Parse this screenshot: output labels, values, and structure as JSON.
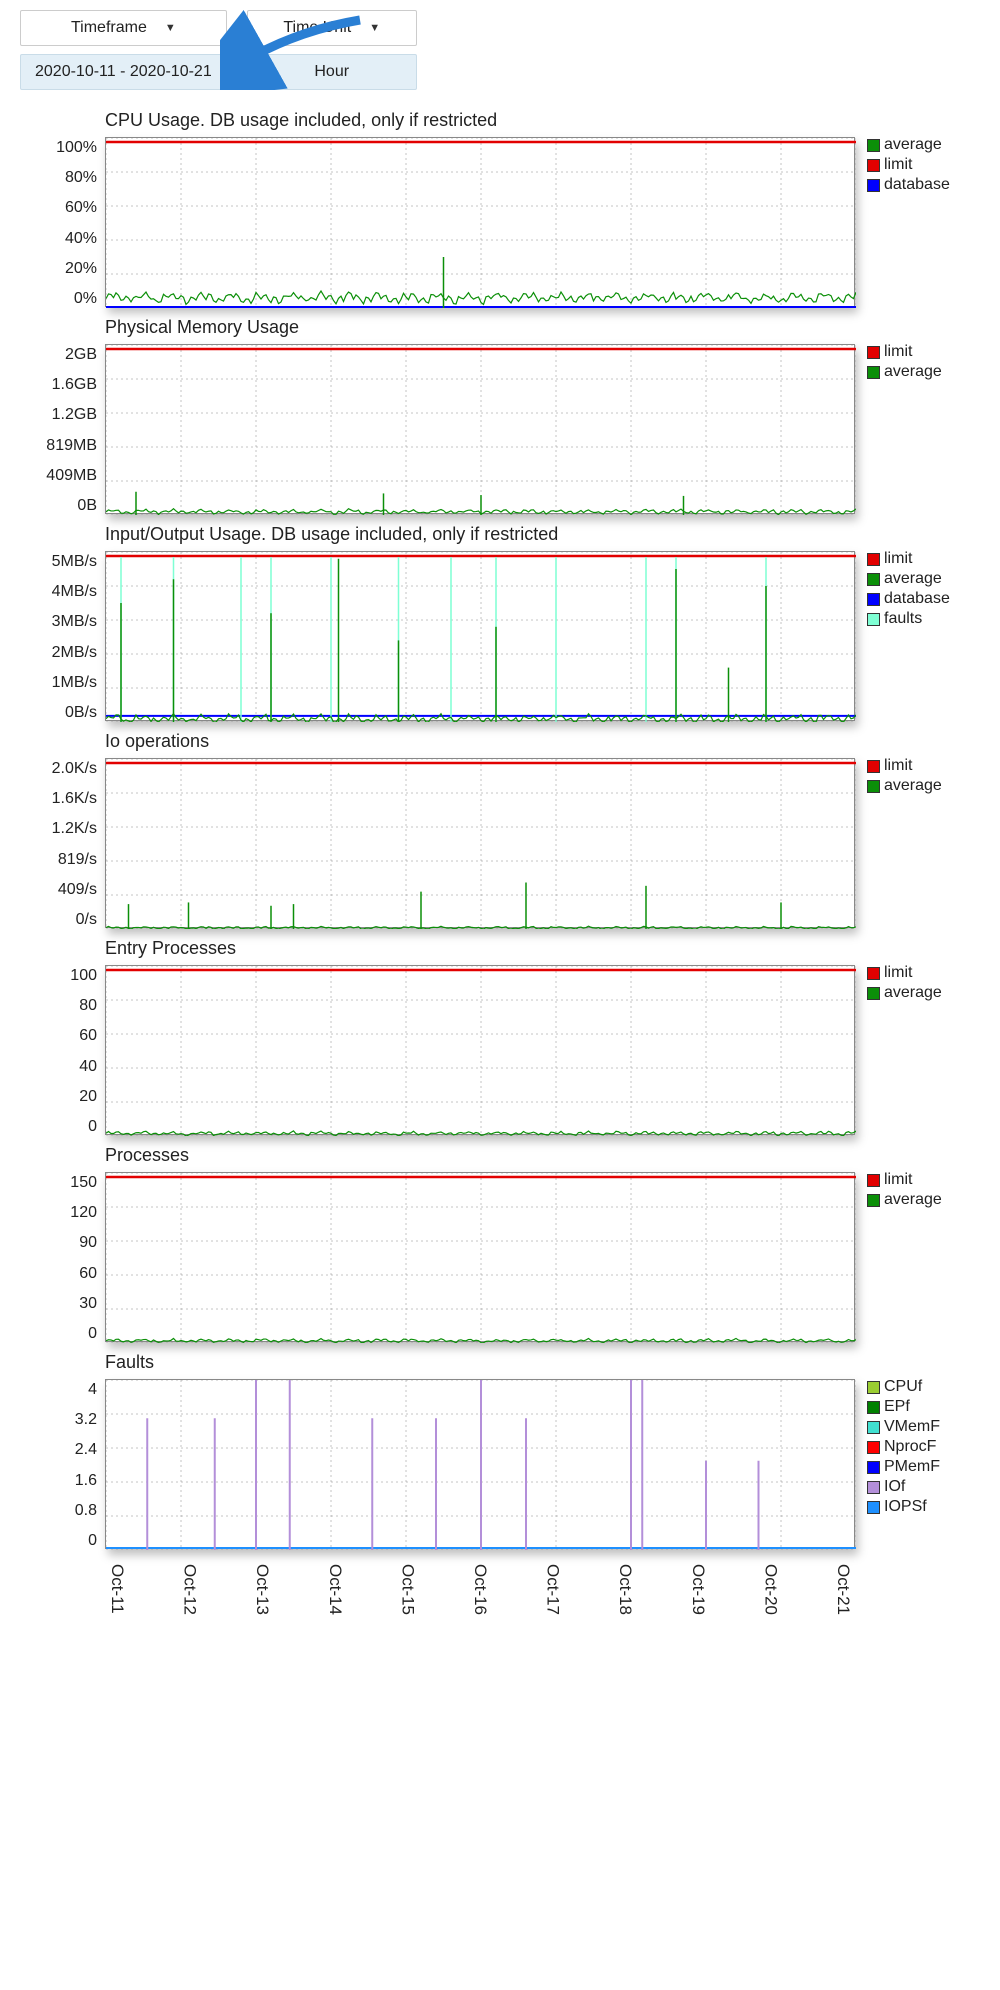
{
  "controls": {
    "timeframe_label": "Timeframe",
    "timeunit_label": "Time Unit",
    "timeframe_value": "2020-10-11 - 2020-10-21",
    "timeunit_value": "Hour"
  },
  "xaxis_labels": [
    "Oct-11",
    "Oct-12",
    "Oct-13",
    "Oct-14",
    "Oct-15",
    "Oct-16",
    "Oct-17",
    "Oct-18",
    "Oct-19",
    "Oct-20",
    "Oct-21"
  ],
  "colors": {
    "average": "#0b8f08",
    "limit": "#e20000",
    "database": "#0000ff",
    "faults": "#7fffd4",
    "CPUf": "#9acd32",
    "EPf": "#008000",
    "VMemF": "#40e0d0",
    "NprocF": "#ff0000",
    "PMemF": "#0000ff",
    "IOf": "#b38fd9",
    "IOPSf": "#1e90ff"
  },
  "chart_data": [
    {
      "id": "cpu",
      "type": "line",
      "title": "CPU Usage. DB usage included, only if restricted",
      "ylabels": [
        "100%",
        "80%",
        "60%",
        "40%",
        "20%",
        "0%"
      ],
      "ymax": 100,
      "limit": 100,
      "legend": [
        {
          "name": "average",
          "color": "#0b8f08"
        },
        {
          "name": "limit",
          "color": "#e20000"
        },
        {
          "name": "database",
          "color": "#0000ff"
        }
      ],
      "series": {
        "average_baseline": 6,
        "average_noise": 4,
        "spikes": [
          {
            "x": 0.45,
            "v": 30
          }
        ],
        "database_baseline": 0
      }
    },
    {
      "id": "pmem",
      "type": "line",
      "title": "Physical Memory Usage",
      "ylabels": [
        "2GB",
        "1.6GB",
        "1.2GB",
        "819MB",
        "409MB",
        "0B"
      ],
      "ymax": 2048,
      "limit": 2048,
      "legend": [
        {
          "name": "limit",
          "color": "#e20000"
        },
        {
          "name": "average",
          "color": "#0b8f08"
        }
      ],
      "series": {
        "average_baseline": 40,
        "average_noise": 35,
        "spikes": [
          {
            "x": 0.04,
            "v": 280
          },
          {
            "x": 0.37,
            "v": 260
          },
          {
            "x": 0.5,
            "v": 240
          },
          {
            "x": 0.77,
            "v": 230
          }
        ]
      }
    },
    {
      "id": "io",
      "type": "line",
      "title": "Input/Output Usage. DB usage included, only if restricted",
      "ylabels": [
        "5MB/s",
        "4MB/s",
        "3MB/s",
        "2MB/s",
        "1MB/s",
        "0B/s"
      ],
      "ymax": 5,
      "limit": 5,
      "legend": [
        {
          "name": "limit",
          "color": "#e20000"
        },
        {
          "name": "average",
          "color": "#0b8f08"
        },
        {
          "name": "database",
          "color": "#0000ff"
        },
        {
          "name": "faults",
          "color": "#7fffd4"
        }
      ],
      "series": {
        "average_baseline": 0.1,
        "average_noise": 0.15,
        "database_baseline": 0.15,
        "fault_spikes": [
          0.02,
          0.09,
          0.18,
          0.22,
          0.3,
          0.39,
          0.46,
          0.52,
          0.6,
          0.72,
          0.76,
          0.88
        ],
        "avg_spikes": [
          {
            "x": 0.02,
            "v": 3.5
          },
          {
            "x": 0.09,
            "v": 4.2
          },
          {
            "x": 0.22,
            "v": 3.2
          },
          {
            "x": 0.31,
            "v": 4.8
          },
          {
            "x": 0.39,
            "v": 2.4
          },
          {
            "x": 0.52,
            "v": 2.8
          },
          {
            "x": 0.76,
            "v": 4.5
          },
          {
            "x": 0.83,
            "v": 1.6
          },
          {
            "x": 0.88,
            "v": 4.0
          }
        ]
      }
    },
    {
      "id": "iops",
      "type": "line",
      "title": "Io operations",
      "ylabels": [
        "2.0K/s",
        "1.6K/s",
        "1.2K/s",
        "819/s",
        "409/s",
        "0/s"
      ],
      "ymax": 2048,
      "limit": 2048,
      "legend": [
        {
          "name": "limit",
          "color": "#e20000"
        },
        {
          "name": "average",
          "color": "#0b8f08"
        }
      ],
      "series": {
        "average_baseline": 15,
        "average_noise": 20,
        "spikes": [
          {
            "x": 0.03,
            "v": 300
          },
          {
            "x": 0.11,
            "v": 320
          },
          {
            "x": 0.22,
            "v": 280
          },
          {
            "x": 0.25,
            "v": 300
          },
          {
            "x": 0.42,
            "v": 450
          },
          {
            "x": 0.56,
            "v": 560
          },
          {
            "x": 0.72,
            "v": 520
          },
          {
            "x": 0.9,
            "v": 320
          }
        ]
      }
    },
    {
      "id": "ep",
      "type": "line",
      "title": "Entry Processes",
      "ylabels": [
        "100",
        "80",
        "60",
        "40",
        "20",
        "0"
      ],
      "ymax": 100,
      "limit": 100,
      "legend": [
        {
          "name": "limit",
          "color": "#e20000"
        },
        {
          "name": "average",
          "color": "#0b8f08"
        }
      ],
      "series": {
        "average_baseline": 1.5,
        "average_noise": 1.5,
        "spikes": []
      }
    },
    {
      "id": "proc",
      "type": "line",
      "title": "Processes",
      "ylabels": [
        "150",
        "120",
        "90",
        "60",
        "30",
        "0"
      ],
      "ymax": 150,
      "limit": 150,
      "legend": [
        {
          "name": "limit",
          "color": "#e20000"
        },
        {
          "name": "average",
          "color": "#0b8f08"
        }
      ],
      "series": {
        "average_baseline": 2,
        "average_noise": 2,
        "spikes": []
      }
    },
    {
      "id": "faults",
      "type": "bar",
      "title": "Faults",
      "ylabels": [
        "4",
        "3.2",
        "2.4",
        "1.6",
        "0.8",
        "0"
      ],
      "ymax": 4,
      "limit": null,
      "legend": [
        {
          "name": "CPUf",
          "color": "#9acd32"
        },
        {
          "name": "EPf",
          "color": "#008000"
        },
        {
          "name": "VMemF",
          "color": "#40e0d0"
        },
        {
          "name": "NprocF",
          "color": "#ff0000"
        },
        {
          "name": "PMemF",
          "color": "#0000ff"
        },
        {
          "name": "IOf",
          "color": "#b38fd9"
        },
        {
          "name": "IOPSf",
          "color": "#1e90ff"
        }
      ],
      "series": {
        "iof_spikes": [
          {
            "x": 0.055,
            "v": 3.1
          },
          {
            "x": 0.145,
            "v": 3.1
          },
          {
            "x": 0.2,
            "v": 4.0
          },
          {
            "x": 0.245,
            "v": 4.0
          },
          {
            "x": 0.355,
            "v": 3.1
          },
          {
            "x": 0.44,
            "v": 3.1
          },
          {
            "x": 0.5,
            "v": 4.0
          },
          {
            "x": 0.56,
            "v": 3.1
          },
          {
            "x": 0.7,
            "v": 4.0
          },
          {
            "x": 0.715,
            "v": 4.0
          },
          {
            "x": 0.8,
            "v": 2.1
          },
          {
            "x": 0.87,
            "v": 2.1
          }
        ],
        "baseline_color": "#1e90ff"
      }
    }
  ]
}
